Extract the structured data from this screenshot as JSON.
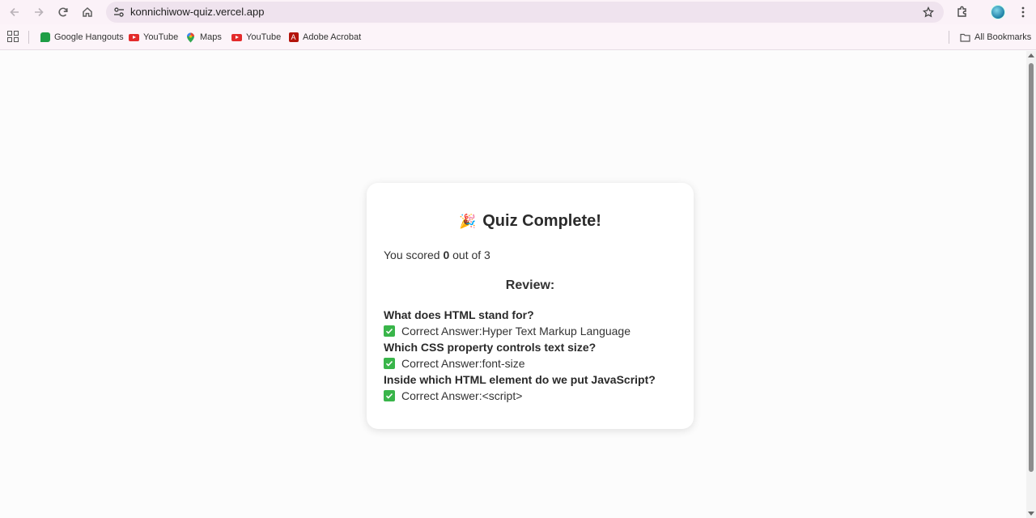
{
  "browser": {
    "url": "konnichiwow-quiz.vercel.app",
    "icons": {
      "back": "back-arrow-icon",
      "forward": "forward-arrow-icon",
      "reload": "reload-icon",
      "home": "home-icon",
      "site_info": "tune-icon",
      "bookmark": "star-icon",
      "extensions": "puzzle-icon",
      "menu": "kebab-menu-icon"
    }
  },
  "bookmarks": {
    "items": [
      {
        "label": "Google Hangouts",
        "icon": "hangouts-icon"
      },
      {
        "label": "YouTube",
        "icon": "youtube-icon"
      },
      {
        "label": "Maps",
        "icon": "maps-pin-icon"
      },
      {
        "label": "YouTube",
        "icon": "youtube-icon"
      },
      {
        "label": "Adobe Acrobat",
        "icon": "acrobat-icon"
      }
    ],
    "all_bookmarks": "All Bookmarks"
  },
  "quiz": {
    "title": "Quiz Complete!",
    "score_prefix": "You scored ",
    "score_value": "0",
    "score_suffix": " out of 3",
    "review_heading": "Review:",
    "answer_prefix": "Correct Answer: ",
    "items": [
      {
        "question": "What does HTML stand for?",
        "answer": "Hyper Text Markup Language"
      },
      {
        "question": "Which CSS property controls text size?",
        "answer": "font-size"
      },
      {
        "question": "Inside which HTML element do we put JavaScript?",
        "answer": "<script>"
      }
    ],
    "colors": {
      "check": "#39b54a",
      "card": "#ffffff"
    }
  }
}
